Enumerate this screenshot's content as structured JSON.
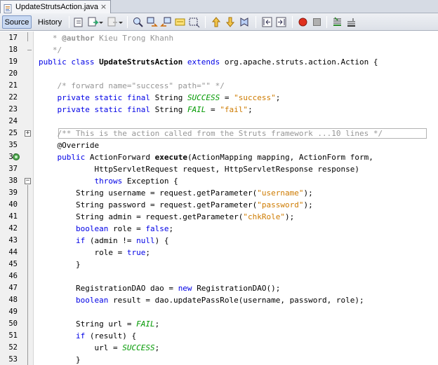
{
  "tab": {
    "file_name": "UpdateStrutsAction.java",
    "close_glyph": "×"
  },
  "toolbar": {
    "source_label": "Source",
    "history_label": "History",
    "icons": [
      "last-edit-icon",
      "back-icon",
      "forward-icon",
      "find-selection-icon",
      "find-previous-icon",
      "find-next-icon",
      "toggle-highlight-icon",
      "toggle-rect-selection-icon",
      "previous-bookmark-icon",
      "next-bookmark-icon",
      "toggle-bookmark-icon",
      "shift-left-icon",
      "shift-right-icon",
      "start-macro-icon",
      "stop-macro-icon",
      "comment-icon",
      "uncomment-icon"
    ]
  },
  "colors": {
    "keyword": "#0000e6",
    "comment": "#969696",
    "string": "#ce7b00",
    "constant": "#009900"
  },
  "editor": {
    "lines": [
      {
        "num": "17",
        "segments": [
          {
            "t": "   * ",
            "c": "cm"
          },
          {
            "t": "@author",
            "c": "cm bold"
          },
          {
            "t": " Kieu Trong Khanh",
            "c": "cm"
          }
        ]
      },
      {
        "num": "18",
        "segments": [
          {
            "t": "   */",
            "c": "cm"
          }
        ]
      },
      {
        "num": "19",
        "segments": [
          {
            "t": "public class ",
            "c": "kw"
          },
          {
            "t": "UpdateStrutsAction",
            "c": "bold"
          },
          {
            "t": " extends ",
            "c": "kw"
          },
          {
            "t": "org.apache.struts.action.Action {",
            "c": ""
          }
        ]
      },
      {
        "num": "20",
        "segments": []
      },
      {
        "num": "21",
        "segments": [
          {
            "t": "    /* forward name=\"success\" path=\"\" */",
            "c": "cm"
          }
        ]
      },
      {
        "num": "22",
        "segments": [
          {
            "t": "    private static final ",
            "c": "kw"
          },
          {
            "t": "String ",
            "c": ""
          },
          {
            "t": "SUCCESS",
            "c": "cst"
          },
          {
            "t": " = ",
            "c": ""
          },
          {
            "t": "\"success\"",
            "c": "str"
          },
          {
            "t": ";",
            "c": ""
          }
        ]
      },
      {
        "num": "23",
        "segments": [
          {
            "t": "    private static final ",
            "c": "kw"
          },
          {
            "t": "String ",
            "c": ""
          },
          {
            "t": "FAIL",
            "c": "cst"
          },
          {
            "t": " = ",
            "c": ""
          },
          {
            "t": "\"fail\"",
            "c": "str"
          },
          {
            "t": ";",
            "c": ""
          }
        ]
      },
      {
        "num": "24",
        "segments": []
      },
      {
        "num": "25",
        "segments": [
          {
            "t": "    /** This is the action called from the Struts framework ...10 lines */",
            "c": "cm"
          }
        ]
      },
      {
        "num": "35",
        "segments": [
          {
            "t": "    @Override",
            "c": "ann"
          }
        ]
      },
      {
        "num": "36",
        "segments": [
          {
            "t": "    public ",
            "c": "kw"
          },
          {
            "t": "ActionForward ",
            "c": ""
          },
          {
            "t": "execute",
            "c": "bold"
          },
          {
            "t": "(ActionMapping mapping, ActionForm form,",
            "c": ""
          }
        ]
      },
      {
        "num": "37",
        "segments": [
          {
            "t": "            HttpServletRequest request, HttpServletResponse response)",
            "c": ""
          }
        ]
      },
      {
        "num": "38",
        "segments": [
          {
            "t": "            throws ",
            "c": "kw"
          },
          {
            "t": "Exception {",
            "c": ""
          }
        ]
      },
      {
        "num": "39",
        "segments": [
          {
            "t": "        String username = request.getParameter(",
            "c": ""
          },
          {
            "t": "\"username\"",
            "c": "str"
          },
          {
            "t": ");",
            "c": ""
          }
        ]
      },
      {
        "num": "40",
        "segments": [
          {
            "t": "        String password = request.getParameter(",
            "c": ""
          },
          {
            "t": "\"password\"",
            "c": "str"
          },
          {
            "t": ");",
            "c": ""
          }
        ]
      },
      {
        "num": "41",
        "segments": [
          {
            "t": "        String admin = request.getParameter(",
            "c": ""
          },
          {
            "t": "\"chkRole\"",
            "c": "str"
          },
          {
            "t": ");",
            "c": ""
          }
        ]
      },
      {
        "num": "42",
        "segments": [
          {
            "t": "        boolean ",
            "c": "kw"
          },
          {
            "t": "role = ",
            "c": ""
          },
          {
            "t": "false",
            "c": "kw"
          },
          {
            "t": ";",
            "c": ""
          }
        ]
      },
      {
        "num": "43",
        "segments": [
          {
            "t": "        if ",
            "c": "kw"
          },
          {
            "t": "(admin != ",
            "c": ""
          },
          {
            "t": "null",
            "c": "kw"
          },
          {
            "t": ") {",
            "c": ""
          }
        ]
      },
      {
        "num": "44",
        "segments": [
          {
            "t": "            role = ",
            "c": ""
          },
          {
            "t": "true",
            "c": "kw"
          },
          {
            "t": ";",
            "c": ""
          }
        ]
      },
      {
        "num": "45",
        "segments": [
          {
            "t": "        }",
            "c": ""
          }
        ]
      },
      {
        "num": "46",
        "segments": []
      },
      {
        "num": "47",
        "segments": [
          {
            "t": "        RegistrationDAO dao = ",
            "c": ""
          },
          {
            "t": "new ",
            "c": "kw"
          },
          {
            "t": "RegistrationDAO();",
            "c": ""
          }
        ]
      },
      {
        "num": "48",
        "segments": [
          {
            "t": "        boolean ",
            "c": "kw"
          },
          {
            "t": "result = dao.updatePassRole(username, password, role);",
            "c": ""
          }
        ]
      },
      {
        "num": "49",
        "segments": []
      },
      {
        "num": "50",
        "segments": [
          {
            "t": "        String url = ",
            "c": ""
          },
          {
            "t": "FAIL",
            "c": "cst"
          },
          {
            "t": ";",
            "c": ""
          }
        ]
      },
      {
        "num": "51",
        "segments": [
          {
            "t": "        if ",
            "c": "kw"
          },
          {
            "t": "(result) {",
            "c": ""
          }
        ]
      },
      {
        "num": "52",
        "segments": [
          {
            "t": "            url = ",
            "c": ""
          },
          {
            "t": "SUCCESS",
            "c": "cst"
          },
          {
            "t": ";",
            "c": ""
          }
        ]
      },
      {
        "num": "53",
        "segments": [
          {
            "t": "        }",
            "c": ""
          }
        ]
      }
    ]
  }
}
